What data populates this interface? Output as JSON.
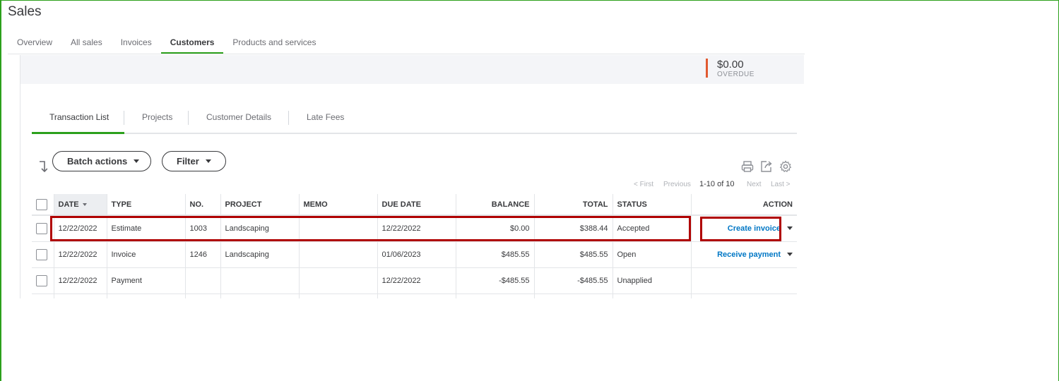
{
  "page": {
    "title": "Sales"
  },
  "main_tabs": [
    {
      "label": "Overview"
    },
    {
      "label": "All sales"
    },
    {
      "label": "Invoices"
    },
    {
      "label": "Customers",
      "active": true
    },
    {
      "label": "Products and services"
    }
  ],
  "summary": {
    "overdue_amount": "$0.00",
    "overdue_label": "OVERDUE",
    "bar_color": "#e15a31"
  },
  "sub_tabs": [
    {
      "label": "Transaction List",
      "active": true
    },
    {
      "label": "Projects"
    },
    {
      "label": "Customer Details"
    },
    {
      "label": "Late Fees"
    }
  ],
  "toolbar": {
    "batch_actions_label": "Batch actions",
    "filter_label": "Filter",
    "icons": [
      "sort-icon",
      "print-icon",
      "export-icon",
      "gear-icon"
    ]
  },
  "pagination": {
    "first": "< First",
    "previous": "Previous",
    "range": "1-10 of 10",
    "next": "Next",
    "last": "Last >"
  },
  "table": {
    "columns": [
      "DATE",
      "TYPE",
      "NO.",
      "PROJECT",
      "MEMO",
      "DUE DATE",
      "BALANCE",
      "TOTAL",
      "STATUS",
      "ACTION"
    ],
    "rows": [
      {
        "date": "12/22/2022",
        "type": "Estimate",
        "no": "1003",
        "project": "Landscaping",
        "memo": "",
        "due_date": "12/22/2022",
        "balance": "$0.00",
        "total": "$388.44",
        "status": "Accepted",
        "action": "Create invoice"
      },
      {
        "date": "12/22/2022",
        "type": "Invoice",
        "no": "1246",
        "project": "Landscaping",
        "memo": "",
        "due_date": "01/06/2023",
        "balance": "$485.55",
        "total": "$485.55",
        "status": "Open",
        "action": "Receive payment"
      },
      {
        "date": "12/22/2022",
        "type": "Payment",
        "no": "",
        "project": "",
        "memo": "",
        "due_date": "12/22/2022",
        "balance": "-$485.55",
        "total": "-$485.55",
        "status": "Unapplied",
        "action": ""
      }
    ]
  },
  "colors": {
    "brand_green": "#2ca01c",
    "link_blue": "#0077c5",
    "highlight_red": "#b00000"
  }
}
